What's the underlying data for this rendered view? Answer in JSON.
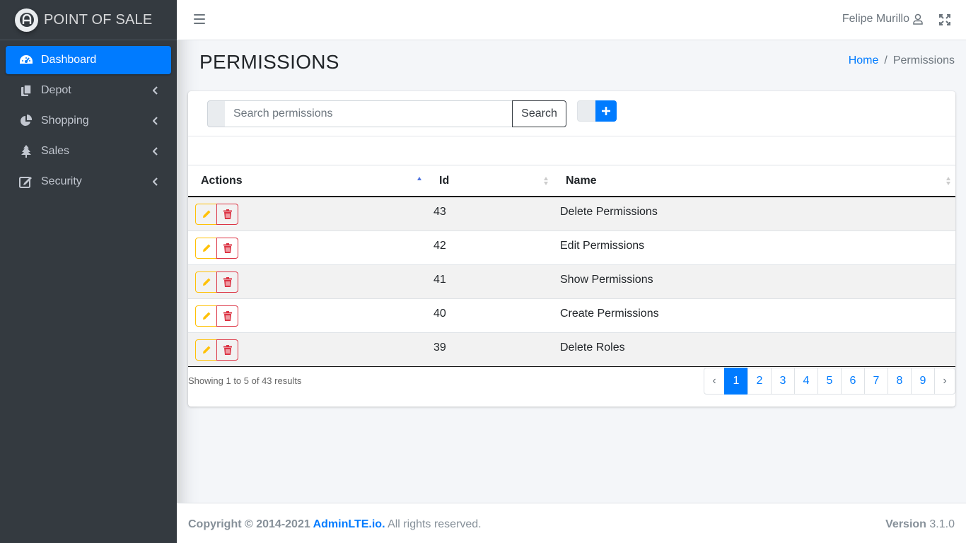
{
  "brand": {
    "name": "POINT OF SALE"
  },
  "sidebar": {
    "items": [
      {
        "label": "Dashboard",
        "icon": "tachometer-icon",
        "active": true
      },
      {
        "label": "Depot",
        "icon": "copy-icon"
      },
      {
        "label": "Shopping",
        "icon": "pie-chart-icon"
      },
      {
        "label": "Sales",
        "icon": "tree-icon"
      },
      {
        "label": "Security",
        "icon": "edit-icon"
      }
    ]
  },
  "navbar": {
    "user_name": "Felipe Murillo"
  },
  "header": {
    "title": "PERMISSIONS",
    "breadcrumb": {
      "home": "Home",
      "separator": "/",
      "current": "Permissions"
    }
  },
  "toolbar": {
    "search_placeholder": "Search permissions",
    "search_label": "Search",
    "add_label": "+"
  },
  "table": {
    "columns": [
      "Actions",
      "Id",
      "Name"
    ],
    "rows": [
      {
        "id": "43",
        "name": "Delete Permissions"
      },
      {
        "id": "42",
        "name": "Edit Permissions"
      },
      {
        "id": "41",
        "name": "Show Permissions"
      },
      {
        "id": "40",
        "name": "Create Permissions"
      },
      {
        "id": "39",
        "name": "Delete Roles"
      }
    ]
  },
  "pagination": {
    "info": "Showing 1 to 5 of 43 results",
    "prev": "‹",
    "next": "›",
    "pages": [
      "1",
      "2",
      "3",
      "4",
      "5",
      "6",
      "7",
      "8",
      "9"
    ],
    "current": "1"
  },
  "footer": {
    "copyright_prefix": "Copyright © 2014-2021 ",
    "link": "AdminLTE.io.",
    "suffix": " All rights reserved.",
    "version_label": "Version",
    "version": "3.1.0"
  },
  "colors": {
    "primary": "#007bff",
    "sidebar": "#343a40",
    "warning": "#ffc107",
    "danger": "#dc3545"
  }
}
